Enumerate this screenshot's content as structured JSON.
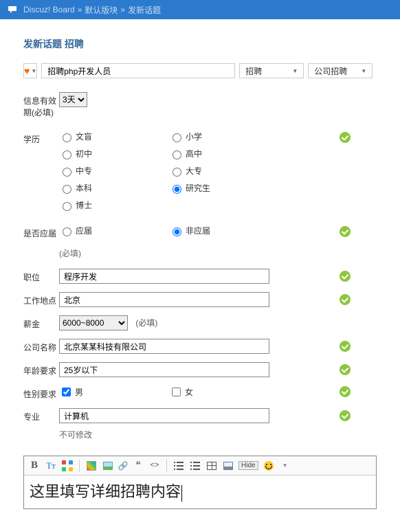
{
  "breadcrumb": {
    "chat_icon": "chat-bubble",
    "board": "Discuz! Board",
    "sep": "»",
    "forum": "默认版块",
    "page": "发新话题"
  },
  "heading": "发新话题 招聘",
  "title_input": {
    "value": "招聘php开发人员"
  },
  "type_select": {
    "value": "招聘"
  },
  "company_type_select": {
    "value": "公司招聘"
  },
  "expiry": {
    "label": "信息有效期(必填)",
    "value": "3天"
  },
  "education": {
    "label": "学历",
    "options": [
      "文盲",
      "小学",
      "初中",
      "高中",
      "中专",
      "大专",
      "本科",
      "研究生",
      "博士"
    ],
    "selected": "研究生"
  },
  "fresh": {
    "label": "是否应届",
    "options": [
      "应届",
      "非应届"
    ],
    "selected": "非应届",
    "note": "(必填)"
  },
  "position": {
    "label": "职位",
    "value": "程序开发"
  },
  "location": {
    "label": "工作地点",
    "value": "北京"
  },
  "salary": {
    "label": "薪金",
    "value": "6000~8000",
    "note": "(必填)"
  },
  "company": {
    "label": "公司名称",
    "value": "北京某某科技有限公司"
  },
  "age": {
    "label": "年龄要求",
    "value": "25岁以下"
  },
  "gender": {
    "label": "性别要求",
    "opt_male": "男",
    "opt_female": "女",
    "male_checked": true,
    "female_checked": false
  },
  "major": {
    "label": "专业",
    "value": "计算机",
    "note": "不可修改"
  },
  "editor": {
    "hide": "Hide",
    "content": "这里填写详细招聘内容"
  }
}
